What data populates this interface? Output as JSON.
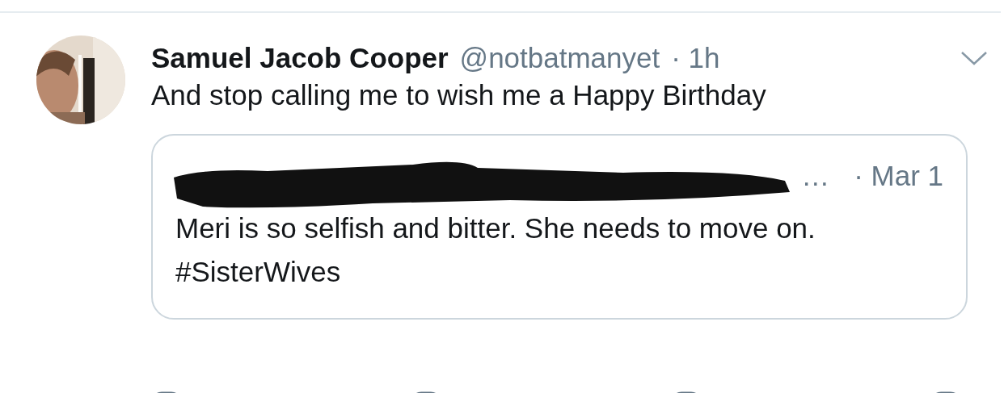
{
  "tweet": {
    "name": "Samuel Jacob Cooper",
    "handle": "@notbatmanyet",
    "time": "· 1h",
    "text": "And stop calling me to wish me a Happy Birthday",
    "quote": {
      "author_tail": "…",
      "time": "· Mar 1",
      "text": "Meri is so selfish and bitter. She needs to move on.   #SisterWives"
    }
  }
}
